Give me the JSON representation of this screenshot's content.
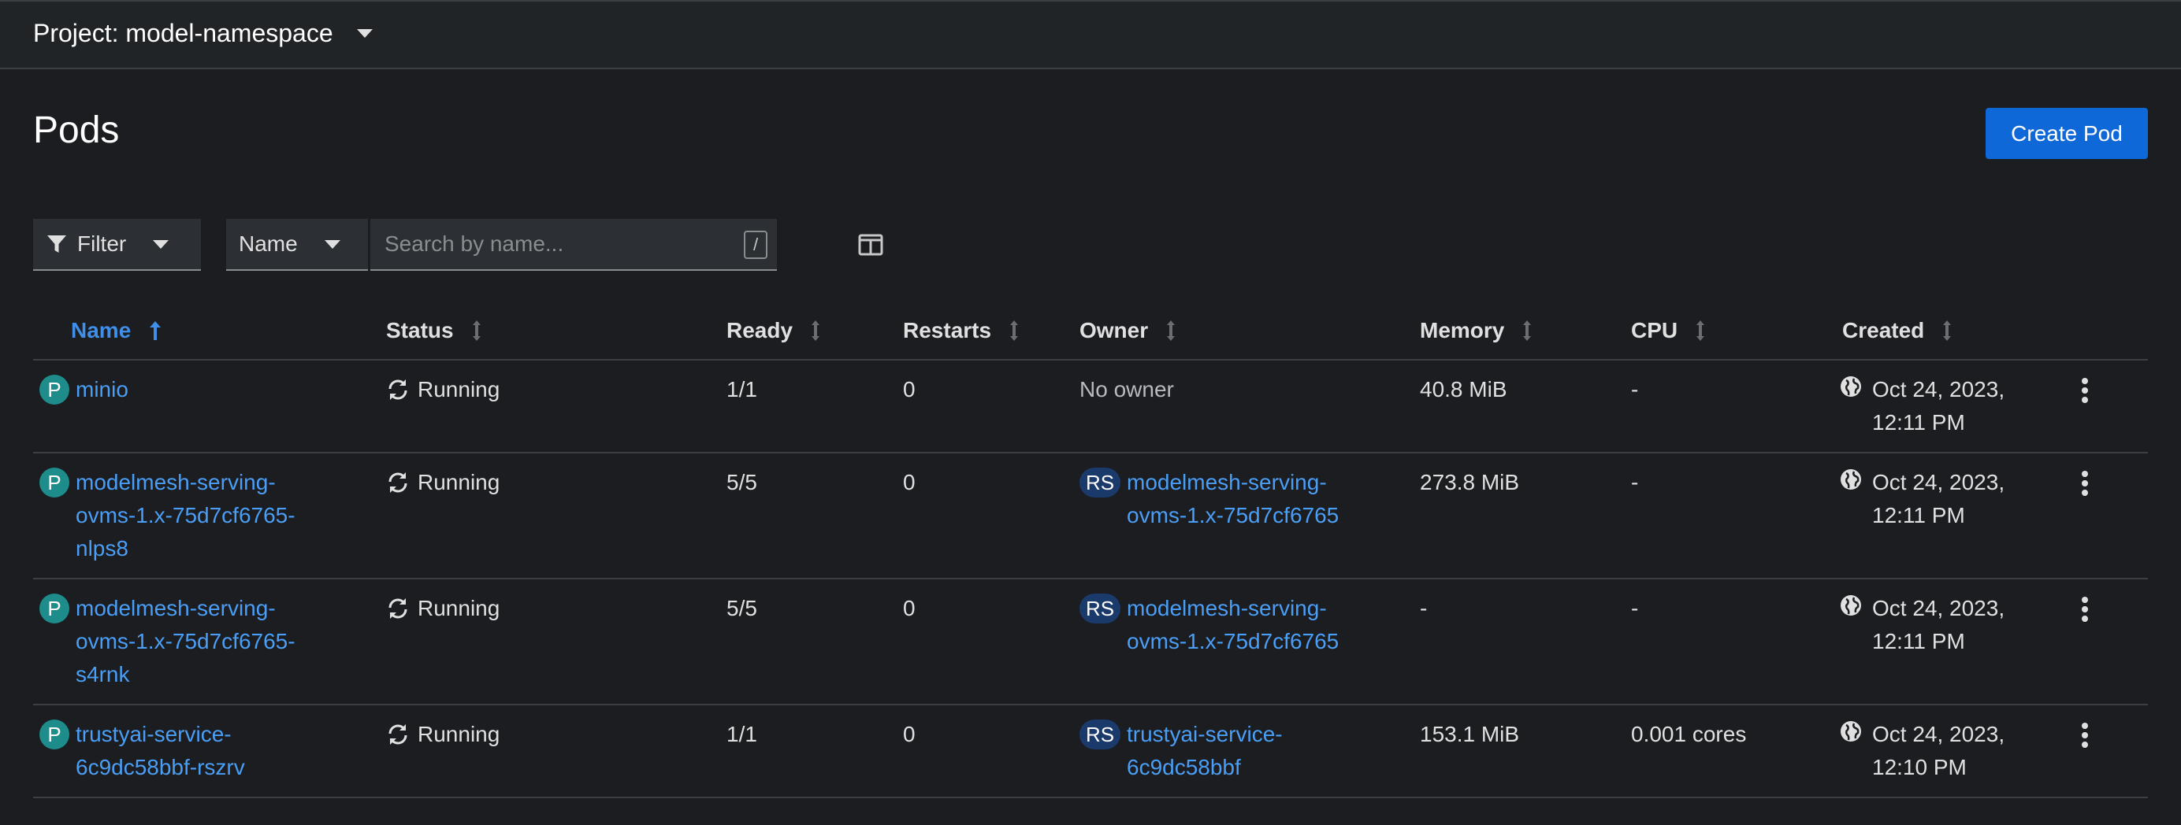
{
  "header": {
    "project_label": "Project: model-namespace"
  },
  "page": {
    "title": "Pods",
    "create_button": "Create Pod"
  },
  "toolbar": {
    "filter_label": "Filter",
    "attribute_select": "Name",
    "search_placeholder": "Search by name...",
    "search_shortcut": "/"
  },
  "table": {
    "columns": {
      "name": "Name",
      "status": "Status",
      "ready": "Ready",
      "restarts": "Restarts",
      "owner": "Owner",
      "memory": "Memory",
      "cpu": "CPU",
      "created": "Created"
    },
    "rows": [
      {
        "badge": "P",
        "name_lines": [
          "minio"
        ],
        "status": "Running",
        "ready": "1/1",
        "restarts": "0",
        "owner_badge": "",
        "owner_lines": [
          "No owner"
        ],
        "memory": "40.8 MiB",
        "cpu": "-",
        "created_lines": [
          "Oct 24, 2023,",
          "12:11 PM"
        ]
      },
      {
        "badge": "P",
        "name_lines": [
          "modelmesh-serving-",
          "ovms-1.x-75d7cf6765-",
          "nlps8"
        ],
        "status": "Running",
        "ready": "5/5",
        "restarts": "0",
        "owner_badge": "RS",
        "owner_lines": [
          "modelmesh-serving-",
          "ovms-1.x-75d7cf6765"
        ],
        "memory": "273.8 MiB",
        "cpu": "-",
        "created_lines": [
          "Oct 24, 2023,",
          "12:11 PM"
        ]
      },
      {
        "badge": "P",
        "name_lines": [
          "modelmesh-serving-",
          "ovms-1.x-75d7cf6765-",
          "s4rnk"
        ],
        "status": "Running",
        "ready": "5/5",
        "restarts": "0",
        "owner_badge": "RS",
        "owner_lines": [
          "modelmesh-serving-",
          "ovms-1.x-75d7cf6765"
        ],
        "memory": "-",
        "cpu": "-",
        "created_lines": [
          "Oct 24, 2023,",
          "12:11 PM"
        ]
      },
      {
        "badge": "P",
        "name_lines": [
          "trustyai-service-",
          "6c9dc58bbf-rszrv"
        ],
        "status": "Running",
        "ready": "1/1",
        "restarts": "0",
        "owner_badge": "RS",
        "owner_lines": [
          "trustyai-service-",
          "6c9dc58bbf"
        ],
        "memory": "153.1 MiB",
        "cpu": "0.001 cores",
        "created_lines": [
          "Oct 24, 2023,",
          "12:10 PM"
        ]
      }
    ]
  },
  "colors": {
    "background": "#1b1d21",
    "header_bg": "#212427",
    "primary_button": "#0f68d8",
    "link": "#4a9ef5",
    "pod_badge": "#1d8c8a",
    "rs_badge": "#1a3a6b"
  },
  "icons": {
    "project_caret": "caret-down-icon",
    "filter": "funnel-icon",
    "columns": "manage-columns-icon",
    "sort_active": "arrow-up-icon",
    "sort_inactive": "sort-arrows-icon",
    "status": "sync-icon",
    "created": "globe-icon",
    "row_actions": "kebab-icon"
  }
}
